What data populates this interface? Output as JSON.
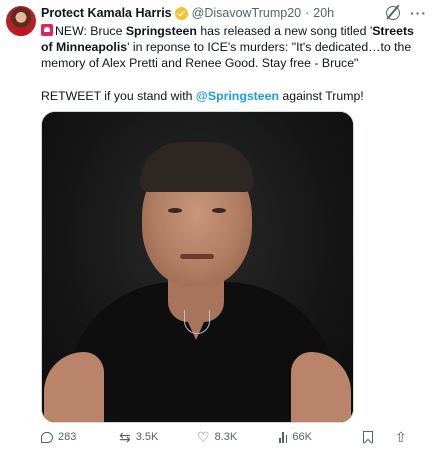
{
  "tweet": {
    "author": {
      "display_name": "Protect Kamala Harris",
      "handle": "@DisavowTrump20",
      "separator": "·",
      "time": "20h",
      "badge_color": "#f4c430",
      "avatar_icon": "avatar"
    },
    "text": {
      "p1_prefix": "NEW: Bruce ",
      "p1_bold1": "Springsteen",
      "p1_mid": " has released a new song titled '",
      "p1_bold2": "Streets of Minneapolis",
      "p1_suffix": "' in reponse to ICE's murders: \"It's dedicated…to the memory of Alex Pretti and Renee Good. Stay free - Bruce\"",
      "p2_prefix": "RETWEET if you stand with ",
      "p2_mention": "@Springsteen",
      "p2_suffix": " against Trump!"
    },
    "media": {
      "icon": "photo-icon"
    },
    "stats": {
      "replies": "283",
      "retweets": "3.5K",
      "likes": "8.3K",
      "views": "66K"
    },
    "colors": {
      "accent": "#1d9bf0",
      "muted": "#536471",
      "siren": "#e0245e"
    }
  }
}
